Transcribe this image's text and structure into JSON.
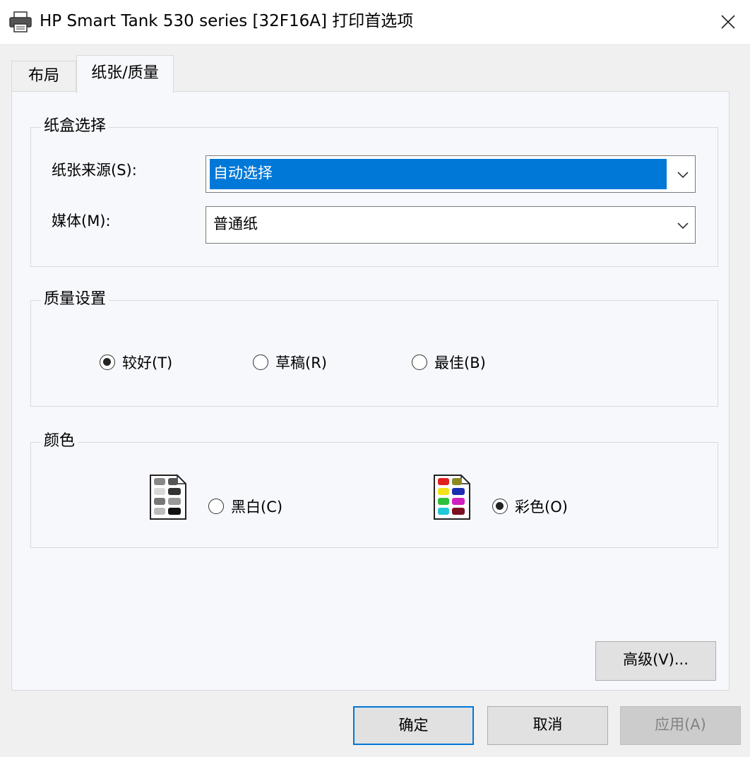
{
  "window": {
    "title": "HP Smart Tank 530 series [32F16A] 打印首选项",
    "title_icon": "printer-icon",
    "close_icon": "close-icon"
  },
  "tabs": [
    {
      "label": "布局",
      "active": false
    },
    {
      "label": "纸张/质量",
      "active": true
    }
  ],
  "tray_group": {
    "legend": "纸盒选择",
    "paper_source_label": "纸张来源(S):",
    "paper_source_value": "自动选择",
    "media_label": "媒体(M):",
    "media_value": "普通纸"
  },
  "quality_group": {
    "legend": "质量设置",
    "options": [
      {
        "label": "较好(T)",
        "selected": true
      },
      {
        "label": "草稿(R)",
        "selected": false
      },
      {
        "label": "最佳(B)",
        "selected": false
      }
    ]
  },
  "color_group": {
    "legend": "颜色",
    "bw": {
      "label": "黑白(C)",
      "selected": false,
      "icon": "grayscale-document-icon"
    },
    "color": {
      "label": "彩色(O)",
      "selected": true,
      "icon": "color-document-icon"
    }
  },
  "advanced_button": "高级(V)...",
  "footer": {
    "ok": "确定",
    "cancel": "取消",
    "apply": "应用(A)"
  },
  "colors": {
    "accent": "#0078d7",
    "panel_bg": "#f7f8fc",
    "window_bg": "#f0f0f0"
  }
}
